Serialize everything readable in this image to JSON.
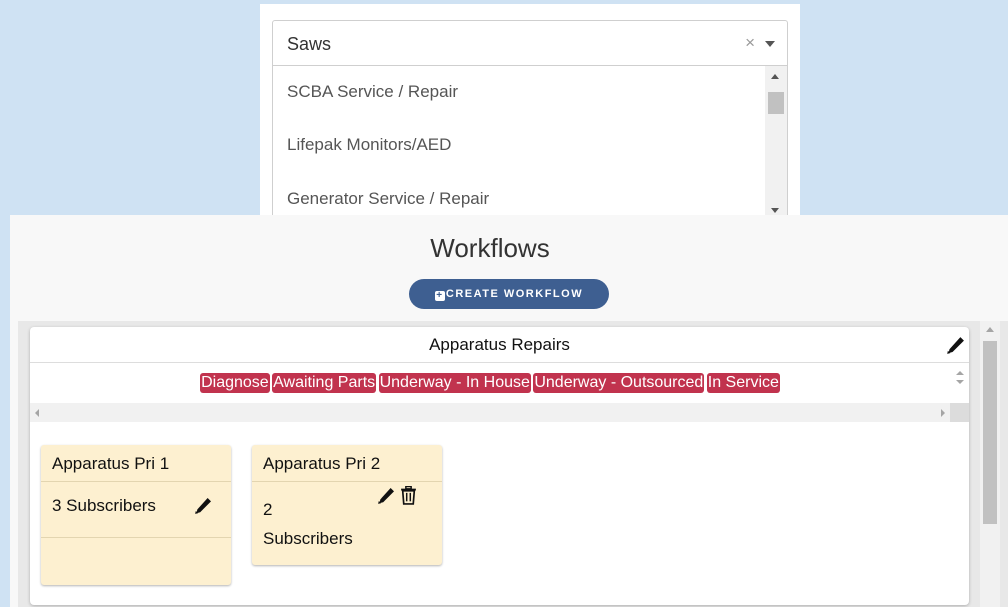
{
  "dropdown": {
    "selected": "Saws",
    "clear_glyph": "×",
    "options": [
      "SCBA Service / Repair",
      "Lifepak Monitors/AED",
      "Generator Service / Repair"
    ]
  },
  "page": {
    "title": "Workflows",
    "create_button": "CREATE WORKFLOW"
  },
  "workflow": {
    "title": "Apparatus Repairs",
    "statuses": [
      "Diagnose",
      "Awaiting Parts",
      "Underway - In House",
      "Underway - Outsourced",
      "In Service"
    ],
    "status_color": "#c1334e",
    "priorities": [
      {
        "title": "Apparatus Pri 1",
        "subscribers": "3 Subscribers"
      },
      {
        "title": "Apparatus Pri 2",
        "subscribers_count": "2",
        "subscribers_word": "Subscribers"
      }
    ]
  },
  "colors": {
    "background": "#cfe2f3",
    "button": "#3e5f91",
    "priority_card": "#fdf0d0"
  },
  "icons": [
    "pencil-icon",
    "trash-icon",
    "plus-square-icon",
    "chevron-down-icon"
  ]
}
